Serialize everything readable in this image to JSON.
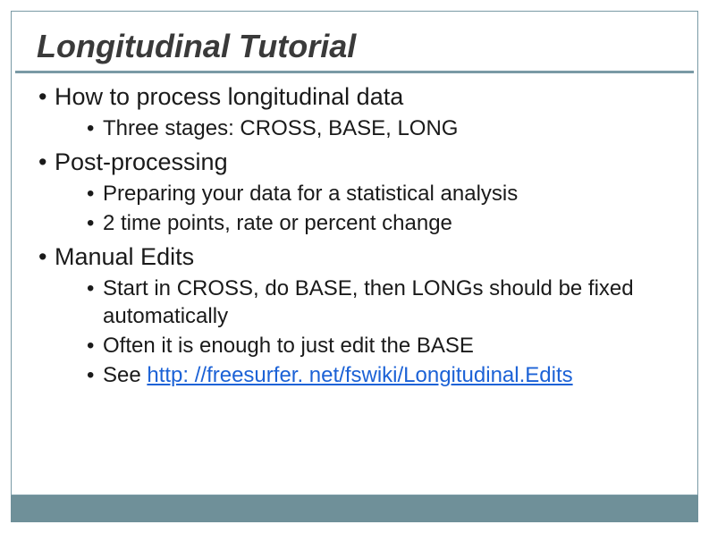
{
  "title": "Longitudinal Tutorial",
  "bullets": {
    "b1": "How to process longitudinal data",
    "b1_1": "Three stages: CROSS, BASE, LONG",
    "b2": "Post-processing",
    "b2_1": "Preparing your data for a statistical analysis",
    "b2_2": "2 time points, rate or percent change",
    "b3": "Manual Edits",
    "b3_1": "Start in CROSS, do BASE, then LONGs should be fixed automatically",
    "b3_2": "Often it is enough to just edit the BASE",
    "b3_3_prefix": "See ",
    "b3_3_link": "http: //freesurfer. net/fswiki/Longitudinal.Edits"
  }
}
